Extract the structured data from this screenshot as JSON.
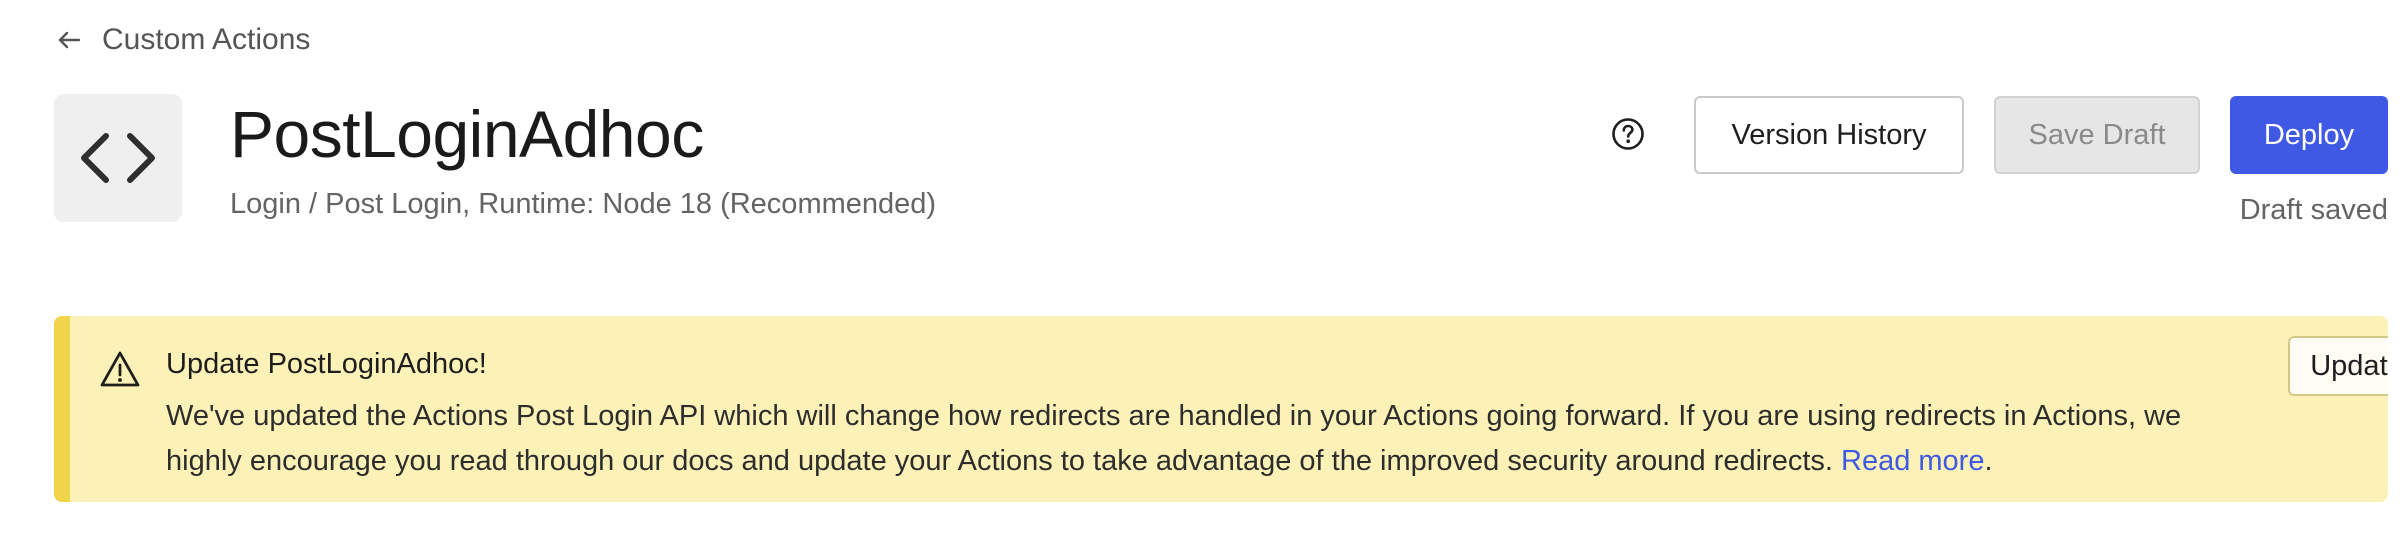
{
  "breadcrumb": {
    "back_label": "Custom Actions",
    "icon": "arrow-left-icon"
  },
  "header": {
    "icon": "code-icon",
    "title": "PostLoginAdhoc",
    "subtitle": "Login / Post Login, Runtime: Node 18 (Recommended)"
  },
  "toolbar": {
    "help_icon": "help-circle-icon",
    "version_history_label": "Version History",
    "save_draft_label": "Save Draft",
    "deploy_label": "Deploy",
    "draft_status": "Draft saved"
  },
  "banner": {
    "icon": "warning-triangle-icon",
    "title": "Update PostLoginAdhoc!",
    "message": "We've updated the Actions Post Login API which will change how redirects are handled in your Actions going forward. If you are using redirects in Actions, we highly encourage you read through our docs and update your Actions to take advantage of the improved security around redirects.",
    "link_label": "Read more",
    "link_suffix": ".",
    "update_label": "Update"
  },
  "colors": {
    "primary": "#3f59e4",
    "banner_background": "#fcf1b7",
    "banner_stripe": "#f0d54a",
    "icon_tile": "#efefef"
  }
}
